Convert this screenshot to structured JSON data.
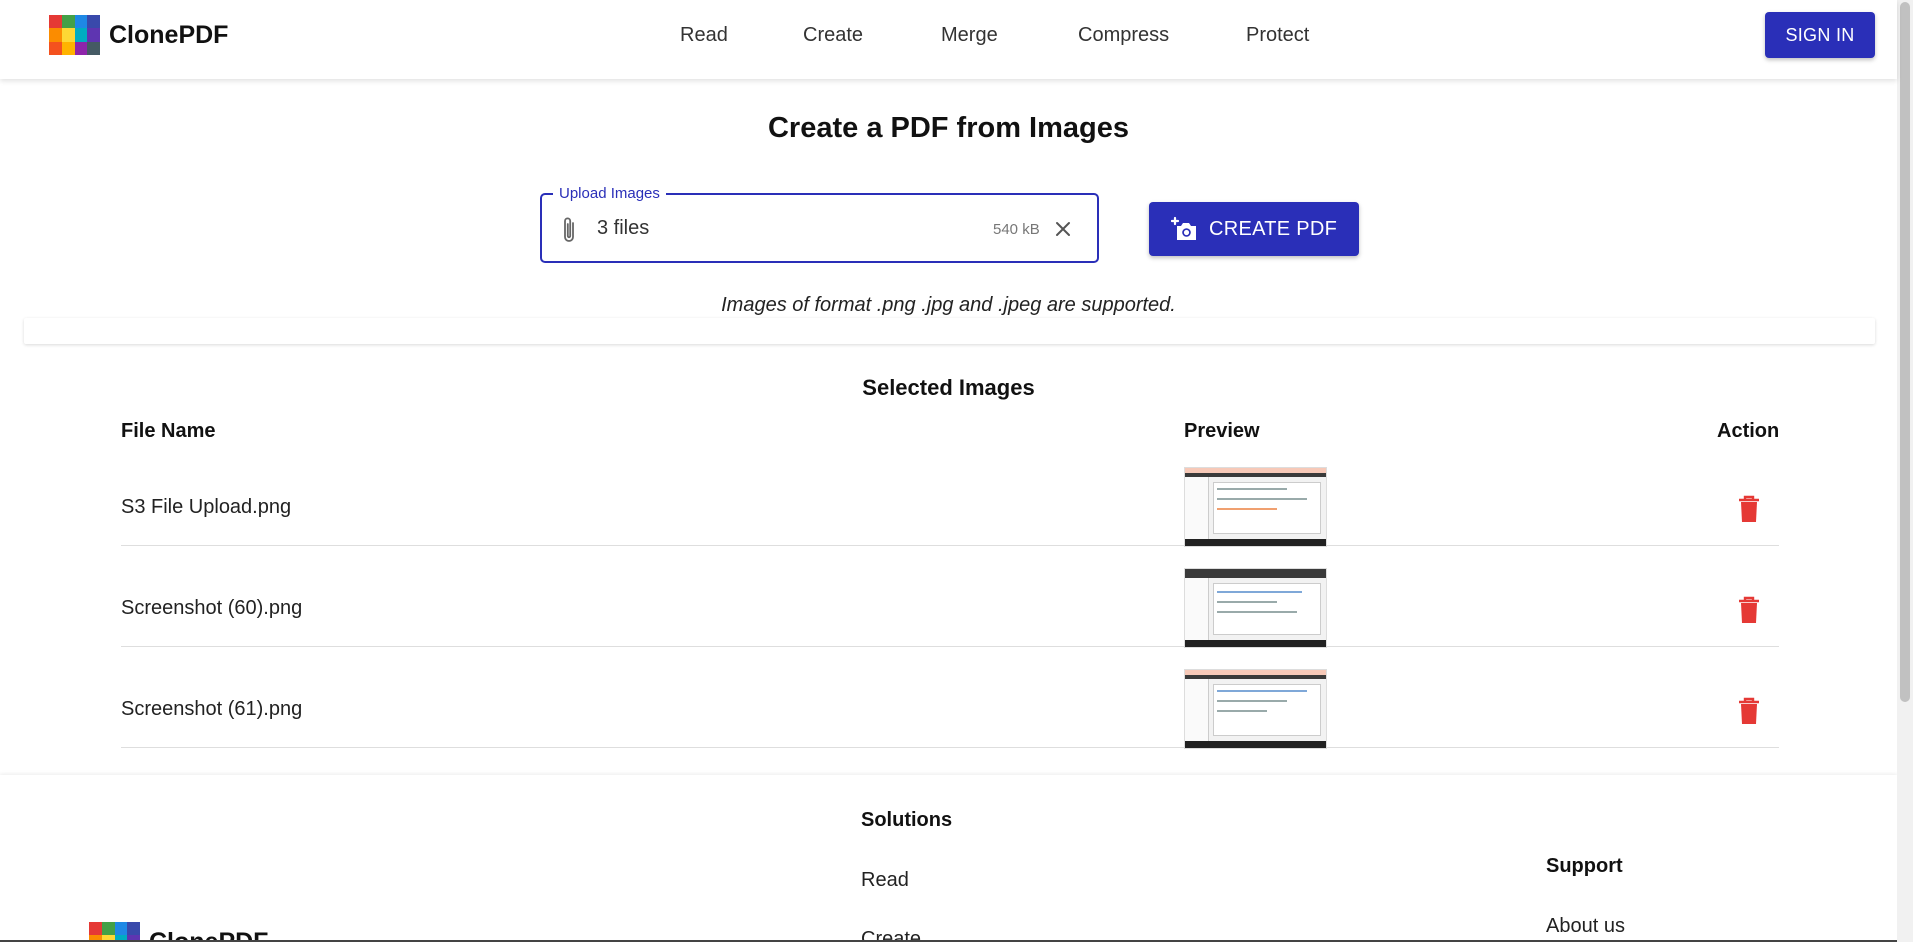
{
  "brand": {
    "name": "ClonePDF",
    "logo_colors": [
      "#e53935",
      "#43a047",
      "#1e88e5",
      "#3949ab",
      "#fb8c00",
      "#fdd835",
      "#00acc1",
      "#5e35b1",
      "#f4511e",
      "#ffb300",
      "#8e24aa",
      "#455a64"
    ]
  },
  "nav": {
    "items": [
      {
        "label": "Read"
      },
      {
        "label": "Create"
      },
      {
        "label": "Merge"
      },
      {
        "label": "Compress"
      },
      {
        "label": "Protect"
      }
    ],
    "sign_in": "SIGN IN"
  },
  "main": {
    "title": "Create a PDF from Images",
    "upload": {
      "legend": "Upload Images",
      "value": "3 files",
      "size": "540 kB"
    },
    "create_button": "CREATE PDF",
    "supported_note": "Images of format .png .jpg and .jpeg are supported."
  },
  "selected": {
    "title": "Selected Images",
    "columns": [
      "File Name",
      "Preview",
      "Action"
    ],
    "rows": [
      {
        "file_name": "S3 File Upload.png"
      },
      {
        "file_name": "Screenshot (60).png"
      },
      {
        "file_name": "Screenshot (61).png"
      }
    ]
  },
  "footer": {
    "solutions": {
      "title": "Solutions",
      "links": [
        "Read",
        "Create"
      ]
    },
    "support": {
      "title": "Support",
      "links": [
        "About us"
      ]
    },
    "brand_name": "ClonePDF"
  },
  "colors": {
    "accent": "#2a2fb8",
    "danger": "#e53935"
  }
}
